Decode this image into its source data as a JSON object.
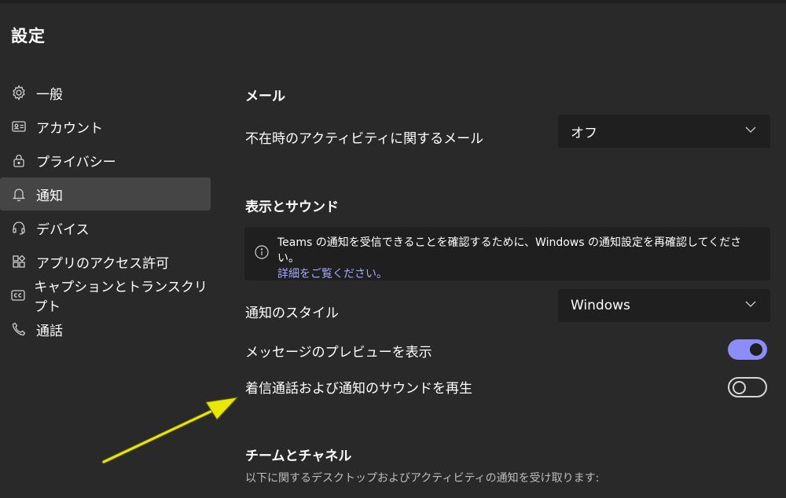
{
  "window": {
    "title": "設定"
  },
  "sidebar": {
    "items": [
      {
        "label": "一般",
        "icon": "gear-icon"
      },
      {
        "label": "アカウント",
        "icon": "id-card-icon"
      },
      {
        "label": "プライバシー",
        "icon": "lock-icon"
      },
      {
        "label": "通知",
        "icon": "bell-icon",
        "active": true
      },
      {
        "label": "デバイス",
        "icon": "headset-icon"
      },
      {
        "label": "アプリのアクセス許可",
        "icon": "apps-icon"
      },
      {
        "label": "キャプションとトランスクリプト",
        "icon": "cc-icon"
      },
      {
        "label": "通話",
        "icon": "phone-icon"
      }
    ]
  },
  "main": {
    "mail": {
      "title": "メール",
      "activity_label": "不在時のアクティビティに関するメール",
      "activity_value": "オフ"
    },
    "display": {
      "title": "表示とサウンド",
      "info_text": "Teams の通知を受信できることを確認するために、Windows の通知設定を再確認してください。",
      "info_link": "詳細をご覧ください。",
      "style_label": "通知のスタイル",
      "style_value": "Windows",
      "preview_label": "メッセージのプレビューを表示",
      "preview_on": true,
      "sound_label": "着信通話および通知のサウンドを再生",
      "sound_on": false
    },
    "teams": {
      "title": "チームとチャネル",
      "subtext": "以下に関するデスクトップおよびアクティビティの通知を受け取ります:"
    }
  },
  "colors": {
    "background": "#292929",
    "panel": "#1f1f1f",
    "active_nav": "#454545",
    "accent": "#8b8ef8",
    "link": "#a5a8ff",
    "annotation_arrow": "#e8e800"
  }
}
